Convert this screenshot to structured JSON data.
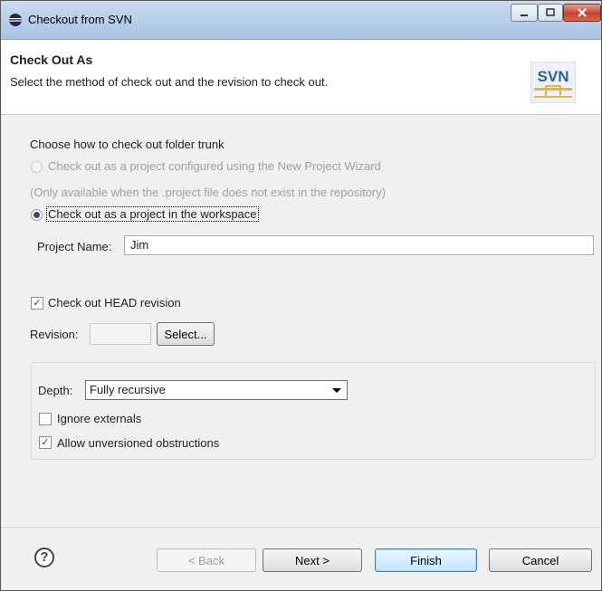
{
  "window": {
    "title": "Checkout from SVN"
  },
  "header": {
    "title": "Check Out As",
    "description": "Select the method of check out and the revision to check out.",
    "logo_text": "SVN"
  },
  "method": {
    "section_label": "Choose how to check out folder trunk",
    "option_wizard": "Check out as a project configured using the New Project Wizard",
    "option_wizard_note": "(Only available when the .project file does not exist in the repository)",
    "option_workspace": "Check out as a project in the workspace",
    "selected": "option_workspace"
  },
  "project": {
    "label": "Project Name:",
    "value": "Jim"
  },
  "revision": {
    "head_label": "Check out HEAD revision",
    "head_checked": true,
    "label": "Revision:",
    "value": "",
    "select_button": "Select..."
  },
  "depth": {
    "label": "Depth:",
    "value": "Fully recursive",
    "ignore_externals_label": "Ignore externals",
    "ignore_externals_checked": false,
    "allow_unversioned_label": "Allow unversioned obstructions",
    "allow_unversioned_checked": true
  },
  "buttons": {
    "help": "?",
    "back": "< Back",
    "next": "Next >",
    "finish": "Finish",
    "cancel": "Cancel"
  }
}
